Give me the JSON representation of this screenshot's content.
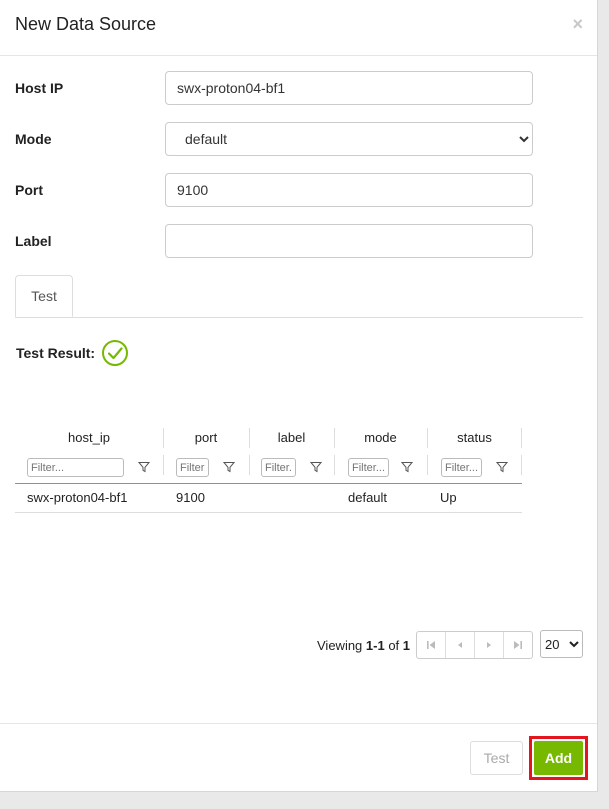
{
  "dialog": {
    "title": "New Data Source",
    "close_glyph": "×"
  },
  "form": {
    "host_ip": {
      "label": "Host IP",
      "value": "swx-proton04-bf1"
    },
    "mode": {
      "label": "Mode",
      "value": "default",
      "options": [
        "default"
      ]
    },
    "port": {
      "label": "Port",
      "value": "9100"
    },
    "label_field": {
      "label": "Label",
      "value": ""
    }
  },
  "tabs": [
    {
      "label": "Test",
      "active": true
    }
  ],
  "test_result": {
    "label": "Test Result:",
    "status_icon": "check-circle-icon"
  },
  "grid": {
    "columns": [
      "host_ip",
      "port",
      "label",
      "mode",
      "status"
    ],
    "filter_placeholder": "Filter...",
    "rows": [
      {
        "host_ip": "swx-proton04-bf1",
        "port": "9100",
        "label": "",
        "mode": "default",
        "status": "Up"
      }
    ]
  },
  "pager": {
    "viewing_prefix": "Viewing ",
    "range": "1-1",
    "of_text": " of ",
    "total": "1",
    "page_size": "20",
    "page_size_options": [
      "20"
    ]
  },
  "footer": {
    "test_label": "Test",
    "add_label": "Add"
  },
  "colors": {
    "accent": "#76b900",
    "highlight": "#e4151f"
  }
}
